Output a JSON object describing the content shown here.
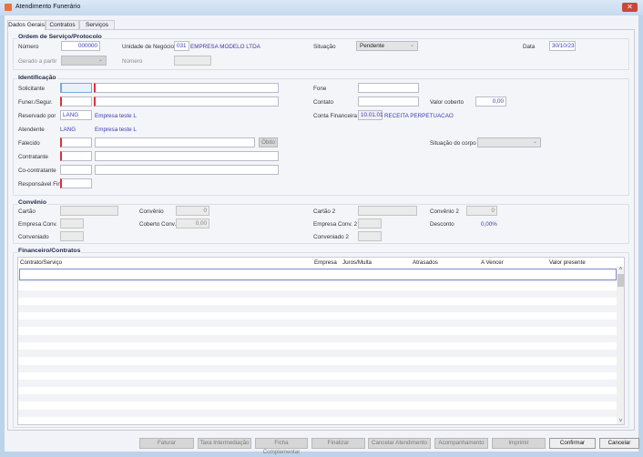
{
  "window": {
    "title": "Atendimento Funerário",
    "close_icon": "close-icon"
  },
  "tabs": [
    "Dados Gerais",
    "Contratos",
    "Serviços"
  ],
  "ordem": {
    "title": "Ordem de Serviço/Protocolo",
    "numero_label": "Número",
    "numero_value": "000000",
    "unidade_label": "Unidade de Negócio",
    "unidade_code": "031",
    "unidade_name": "EMPRESA MODELO LTDA",
    "situacao_label": "Situação",
    "situacao_value": "Pendente",
    "data_label": "Data",
    "data_value": "30/10/23",
    "gerado_label": "Gerado a partir",
    "gerado_value": "",
    "numero2_label": "Número",
    "numero2_value": ""
  },
  "identificacao": {
    "title": "Identificação",
    "solicitante_label": "Solicitante",
    "funer_label": "Funer./Segur.",
    "reservado_label": "Reservado por",
    "reservado_value": "LANG",
    "reservado_name": "Empresa teste L",
    "atendente_label": "Atendente",
    "atendente_value": "LANG",
    "atendente_name": "Empresa teste L",
    "falecido_label": "Falecido",
    "obito_button": "Óbito",
    "contratante_label": "Contratante",
    "cocontratante_label": "Co-contratante",
    "responsavel_label": "Responsável Fin.",
    "fone_label": "Fone",
    "contato_label": "Contato",
    "valor_coberto_label": "Valor coberto",
    "valor_coberto_value": "0,00",
    "conta_label": "Conta Financeira",
    "conta_code": "10.01.01",
    "conta_name": "RECEITA PERPETUACAO",
    "situacao_corpo_label": "Situação do corpo",
    "situacao_corpo_value": ""
  },
  "convenio": {
    "title": "Convênio",
    "cartao_label": "Cartão",
    "convenio_label": "Convênio",
    "convenio_value": "0",
    "empresa_conv_label": "Empresa Conv.",
    "coberto_conv_label": "Coberto Conv.",
    "coberto_conv_value": "0,00",
    "conveniado_label": "Conveniado",
    "cartao2_label": "Cartão 2",
    "convenio2_label": "Convênio 2",
    "convenio2_value": "0",
    "empresa_conv2_label": "Empresa Conv. 2",
    "desconto_label": "Desconto",
    "desconto_value": "0,00%",
    "conveniado2_label": "Conveniado 2"
  },
  "financeiro": {
    "title": "Financeiro/Contratos",
    "columns": [
      "Contrato/Serviço",
      "Empresa",
      "Juros/Multa",
      "Atrasados",
      "A Vencer",
      "Valor presente"
    ],
    "rows": []
  },
  "buttons": [
    {
      "label": "Faturar",
      "enabled": false
    },
    {
      "label": "Taxa Intermediação",
      "enabled": false
    },
    {
      "label": "Ficha Complementar",
      "enabled": false
    },
    {
      "label": "Finalizar",
      "enabled": false
    },
    {
      "label": "Cancelar Atendimento",
      "enabled": false
    },
    {
      "label": "Acompanhamento",
      "enabled": false
    },
    {
      "label": "Imprimir",
      "enabled": false
    },
    {
      "label": "Confirmar",
      "enabled": true
    },
    {
      "label": "Cancelar",
      "enabled": true
    }
  ],
  "colors": {
    "required": "#d9333b",
    "value_text": "#3a3ab0",
    "close": "#c9463a"
  }
}
